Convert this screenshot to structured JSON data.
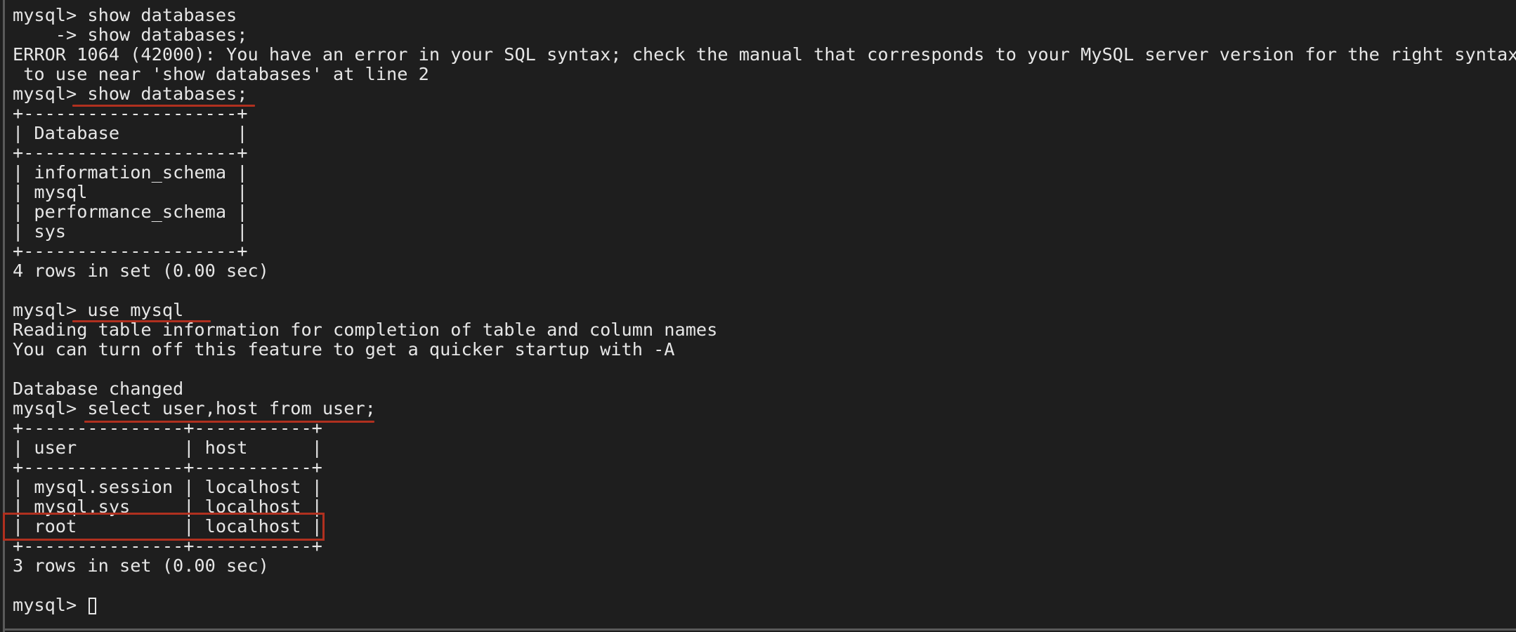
{
  "terminal": {
    "lines": [
      "mysql> show databases",
      "    -> show databases;",
      "ERROR 1064 (42000): You have an error in your SQL syntax; check the manual that corresponds to your MySQL server version for the right syntax",
      " to use near 'show databases' at line 2",
      "mysql> show databases;",
      "+--------------------+",
      "| Database           |",
      "+--------------------+",
      "| information_schema |",
      "| mysql              |",
      "| performance_schema |",
      "| sys                |",
      "+--------------------+",
      "4 rows in set (0.00 sec)",
      "",
      "mysql> use mysql",
      "Reading table information for completion of table and column names",
      "You can turn off this feature to get a quicker startup with -A",
      "",
      "Database changed",
      "mysql> select user,host from user;",
      "+---------------+-----------+",
      "| user          | host      |",
      "+---------------+-----------+",
      "| mysql.session | localhost |",
      "| mysql.sys     | localhost |",
      "| root          | localhost |",
      "+---------------+-----------+",
      "3 rows in set (0.00 sec)",
      ""
    ],
    "prompt": "mysql> "
  },
  "colors": {
    "background": "#1e1e1e",
    "text": "#e6e6e6",
    "annotation": "#b0301f"
  }
}
